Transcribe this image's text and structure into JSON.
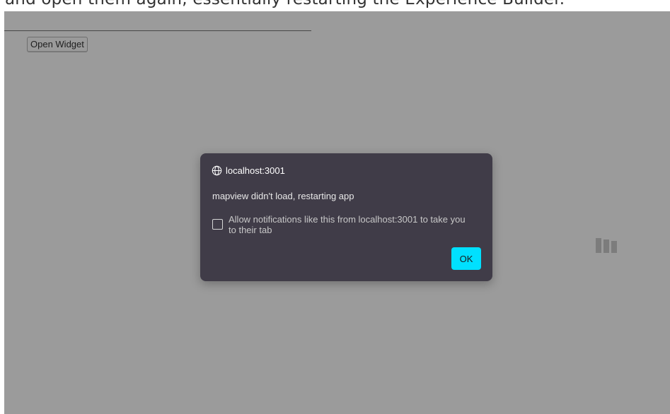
{
  "page": {
    "caption": "and open them again, essentially restarting the Experience Builder."
  },
  "toolbar": {
    "open_widget_label": "Open Widget"
  },
  "dialog": {
    "origin": "localhost:3001",
    "message": "mapview didn't load, restarting app",
    "notify_label": "Allow notifications like this from localhost:3001 to take you to their tab",
    "notify_checked": false,
    "ok_label": "OK"
  },
  "icons": {
    "origin": "globe-icon",
    "loader": "loading-bars-icon"
  },
  "colors": {
    "overlay": "#9b9b9b",
    "dialog_bg": "#403c48",
    "ok_button": "#00e0ff"
  }
}
